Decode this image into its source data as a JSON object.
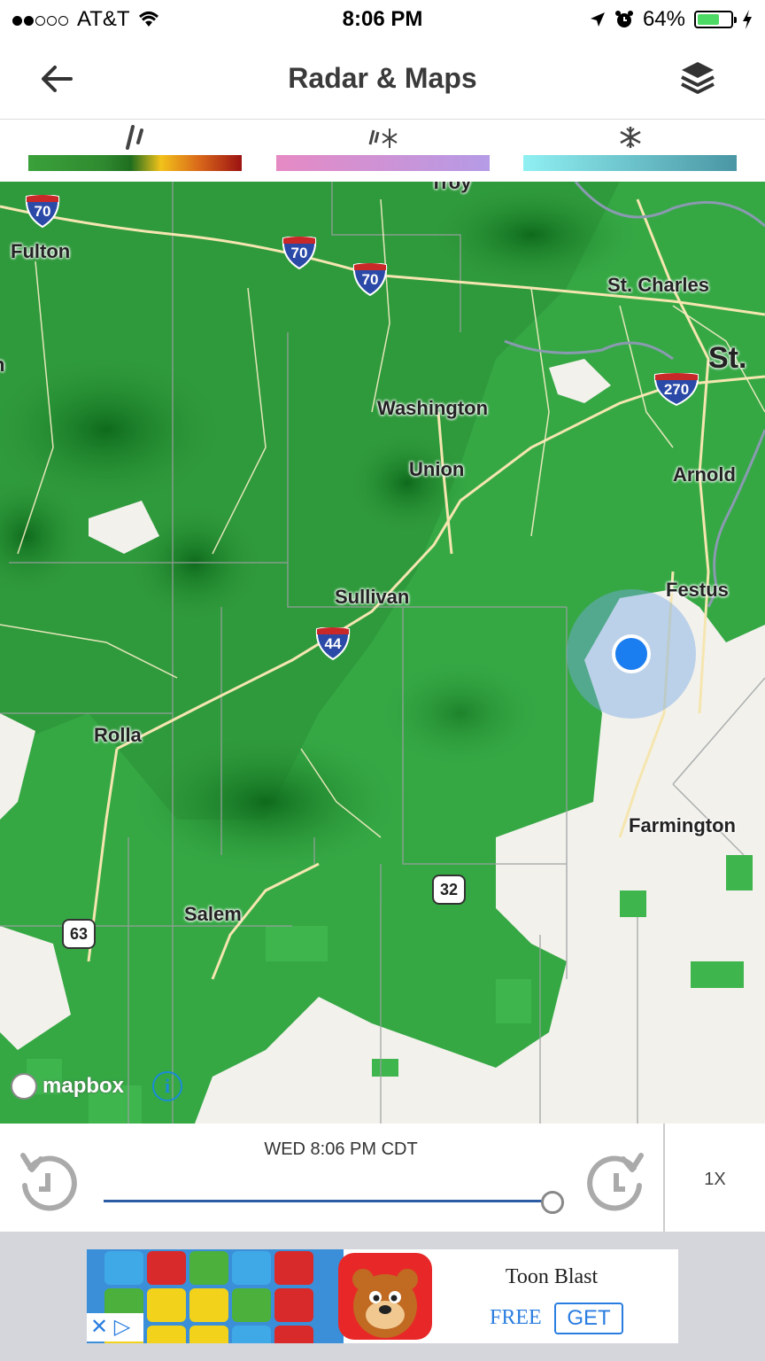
{
  "status_bar": {
    "carrier": "AT&T",
    "time": "8:06 PM",
    "battery": "64%",
    "battery_level": 0.64,
    "signal_bars_filled": 2,
    "signal_bars_total": 5
  },
  "header": {
    "title": "Radar & Maps",
    "back_icon": "arrow-left-icon",
    "layers_icon": "layers-icon"
  },
  "legend": [
    {
      "icon": "rain-icon",
      "colors": [
        "#3aa13a",
        "#1f6e1f",
        "#f2c21a",
        "#9c1212"
      ]
    },
    {
      "icon": "mix-icon",
      "colors": [
        "#e68ac4",
        "#b59be6"
      ]
    },
    {
      "icon": "snow-icon",
      "colors": [
        "#8ff0f2",
        "#4a96a4"
      ]
    }
  ],
  "map": {
    "cities": {
      "troy": "Troy",
      "fulton": "Fulton",
      "st_charles": "St. Charles",
      "st": "St.",
      "washington": "Washington",
      "union": "Union",
      "arnold": "Arnold",
      "sullivan": "Sullivan",
      "festus": "Festus",
      "rolla": "Rolla",
      "farmington": "Farmington",
      "salem": "Salem",
      "edge_n": "n"
    },
    "highways": {
      "i70_a": "70",
      "i70_b": "70",
      "i70_c": "70",
      "i270": "270",
      "i44": "44",
      "us32": "32",
      "us63": "63"
    },
    "attribution": "mapbox",
    "info_label": "i",
    "fab_label": "+"
  },
  "player": {
    "timestamp": "WED 8:06 PM CDT",
    "speed": "1X",
    "progress": 1.0
  },
  "ad": {
    "app_name": "Toon Blast",
    "price": "FREE",
    "cta": "GET",
    "close_label": "✕"
  }
}
